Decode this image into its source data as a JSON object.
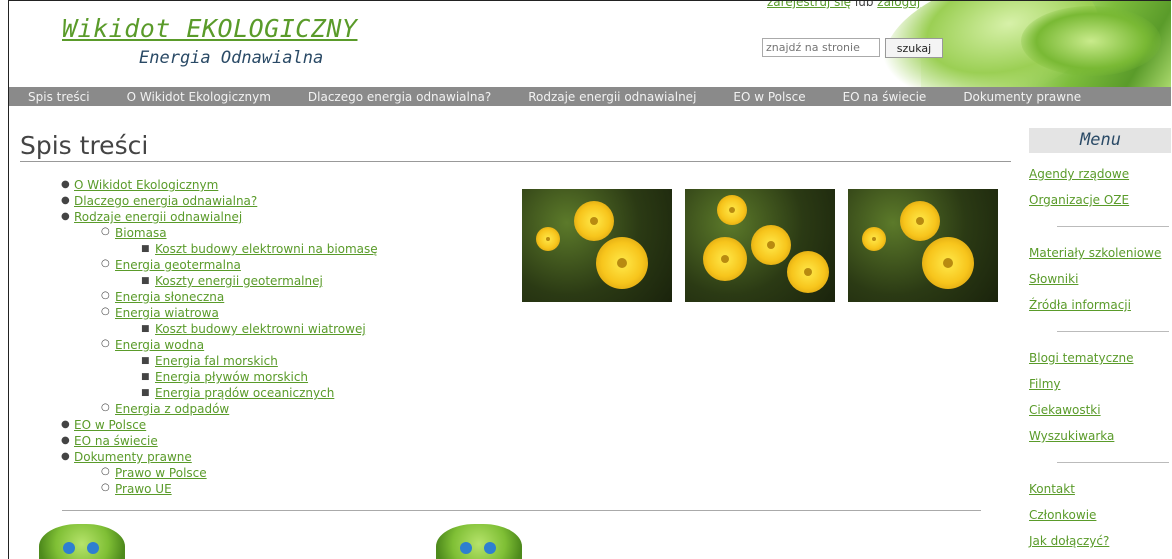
{
  "header": {
    "title": "Wikidot EKOLOGICZNY",
    "subtitle": "Energia Odnawialna",
    "account": {
      "register": "zarejestruj się",
      "or": "lub",
      "login": "zaloguj"
    },
    "search": {
      "placeholder": "znajdź na stronie",
      "button": "szukaj"
    }
  },
  "nav": [
    "Spis treści",
    "O Wikidot Ekologicznym",
    "Dlaczego energia odnawialna?",
    "Rodzaje energii odnawialnej",
    "EO w Polsce",
    "EO na świecie",
    "Dokumenty prawne"
  ],
  "main": {
    "title": "Spis treści",
    "toc": [
      {
        "level": 1,
        "label": "O Wikidot Ekologicznym"
      },
      {
        "level": 1,
        "label": "Dlaczego energia odnawialna?"
      },
      {
        "level": 1,
        "label": "Rodzaje energii odnawialnej"
      },
      {
        "level": 2,
        "label": "Biomasa"
      },
      {
        "level": 3,
        "label": "Koszt budowy elektrowni na biomasę"
      },
      {
        "level": 2,
        "label": "Energia geotermalna"
      },
      {
        "level": 3,
        "label": "Koszty energii geotermalnej"
      },
      {
        "level": 2,
        "label": "Energia słoneczna"
      },
      {
        "level": 2,
        "label": "Energia wiatrowa"
      },
      {
        "level": 3,
        "label": "Koszt budowy elektrowni wiatrowej"
      },
      {
        "level": 2,
        "label": "Energia wodna"
      },
      {
        "level": 3,
        "label": "Energia fal morskich"
      },
      {
        "level": 3,
        "label": "Energia pływów morskich"
      },
      {
        "level": 3,
        "label": "Energia prądów oceanicznych"
      },
      {
        "level": 2,
        "label": "Energia z odpadów"
      },
      {
        "level": 1,
        "label": "EO w Polsce"
      },
      {
        "level": 1,
        "label": "EO na świecie"
      },
      {
        "level": 1,
        "label": "Dokumenty prawne"
      },
      {
        "level": 2,
        "label": "Prawo w Polsce"
      },
      {
        "level": 2,
        "label": "Prawo UE"
      }
    ],
    "photos": [
      "flower-photo",
      "flower-photo",
      "flower-photo"
    ]
  },
  "sidebar": {
    "heading": "Menu",
    "groups": [
      [
        "Agendy rządowe",
        "Organizacje OZE"
      ],
      [
        "Materiały szkoleniowe",
        "Słowniki",
        "Źródła informacji"
      ],
      [
        "Blogi tematyczne",
        "Filmy",
        "Ciekawostki",
        "Wyszukiwarka"
      ],
      [
        "Kontakt",
        "Członkowie",
        "Jak dołączyć?"
      ]
    ]
  }
}
